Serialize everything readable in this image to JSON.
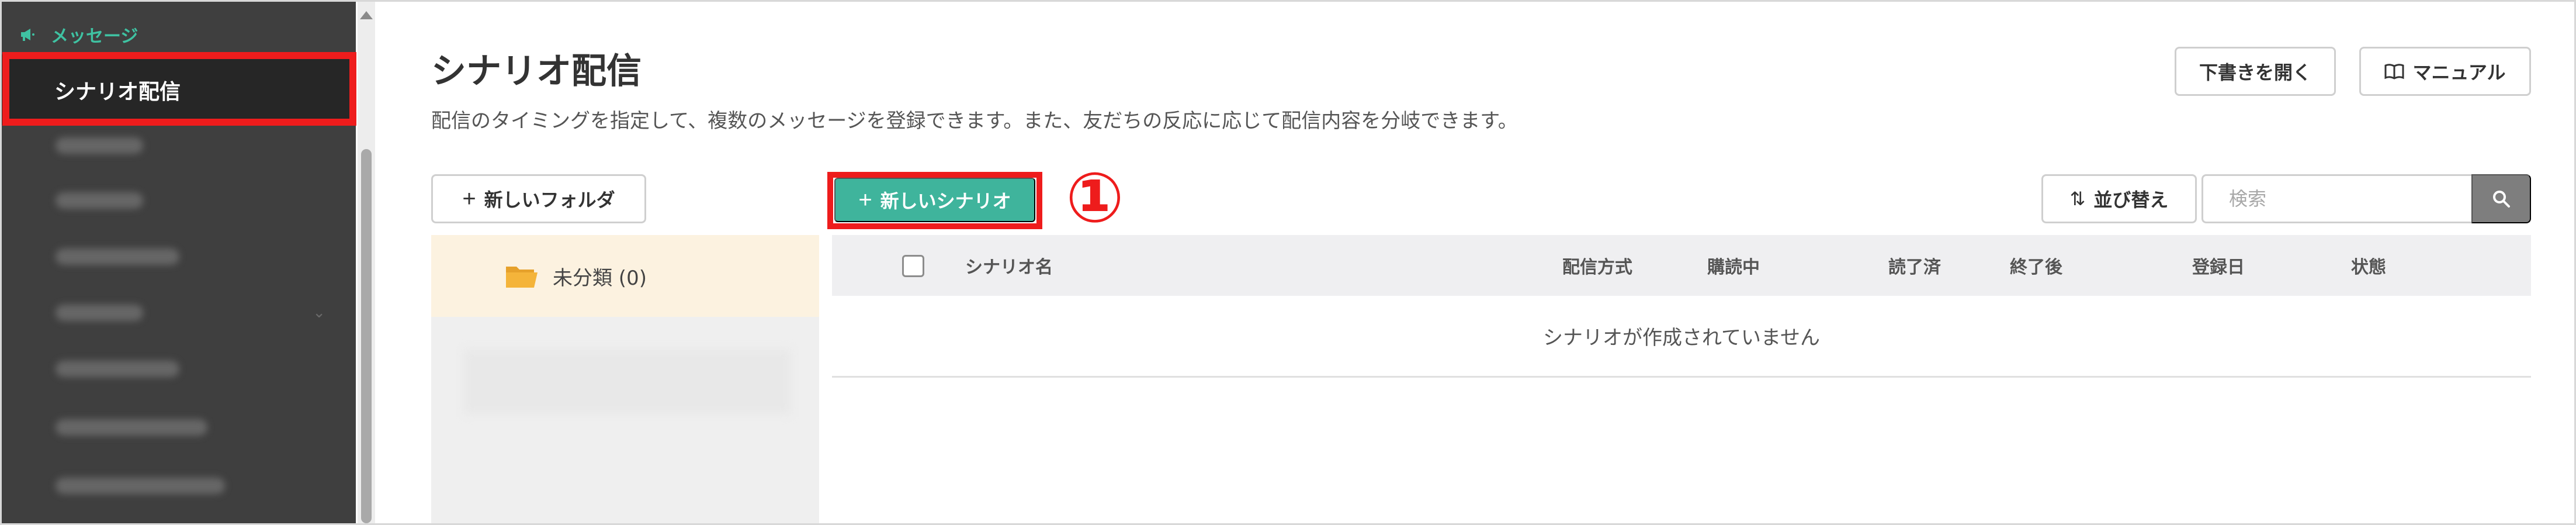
{
  "sidebar": {
    "group_label": "メッセージ",
    "active_item": "シナリオ配信",
    "blurred_items": 7
  },
  "header": {
    "title": "シナリオ配信",
    "description": "配信のタイミングを指定して、複数のメッセージを登録できます。また、友だちの反応に応じて配信内容を分岐できます。",
    "draft_button": "下書きを開く",
    "manual_button": "マニュアル"
  },
  "toolbar": {
    "new_folder": "新しいフォルダ",
    "new_scenario": "新しいシナリオ",
    "callout": "①",
    "sort": "並び替え",
    "search_placeholder": "検索"
  },
  "folders": [
    {
      "label": "未分類 (0)"
    }
  ],
  "table": {
    "columns": [
      "シナリオ名",
      "配信方式",
      "購読中",
      "読了済",
      "終了後",
      "登録日",
      "状態"
    ],
    "empty_message": "シナリオが作成されていません"
  },
  "colors": {
    "sidebar_bg": "#3f3f3f",
    "accent_green": "#3fb49c",
    "highlight_red": "#ee1c1c",
    "folder_selected_bg": "#fcf2e0"
  }
}
